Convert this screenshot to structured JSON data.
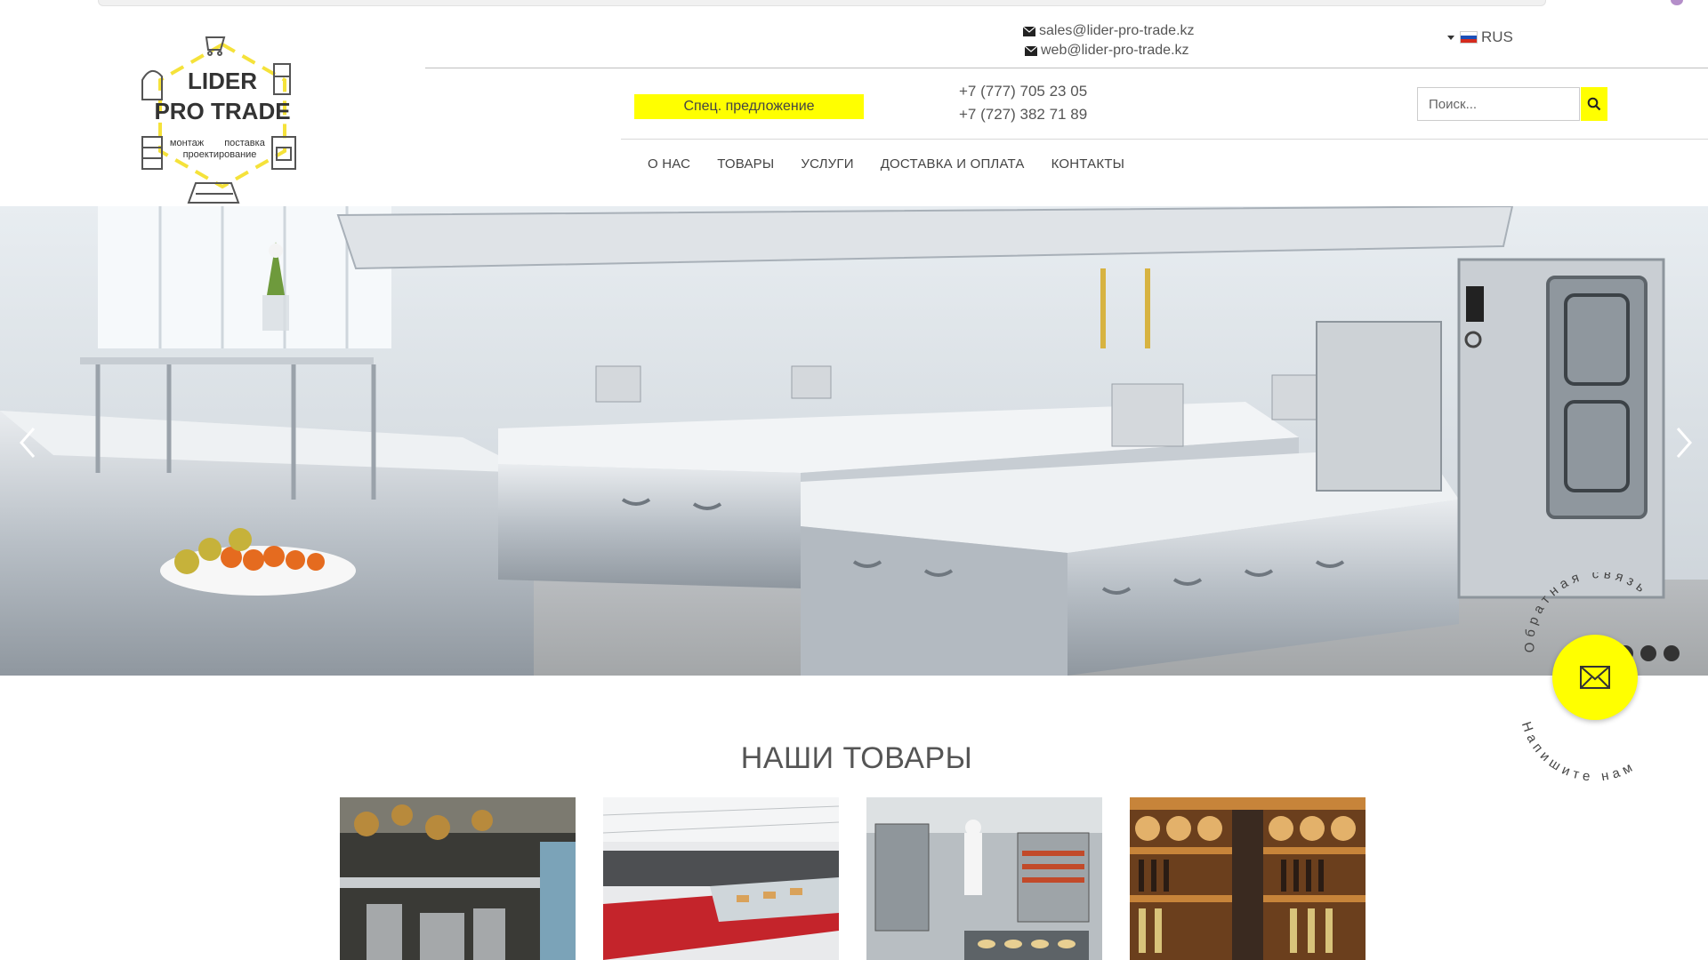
{
  "brand": {
    "logo_line1": "LIDER",
    "logo_line2": "PRO TRADE",
    "logo_tag1": "монтаж",
    "logo_tag2": "поставка",
    "logo_tag3": "проектирование",
    "accent": "#ffff00"
  },
  "header": {
    "email1": "sales@lider-pro-trade.kz",
    "email2": "web@lider-pro-trade.kz",
    "language": "RUS",
    "special_offer": "Спец. предложение",
    "phone1": "+7 (777) 705 23 05",
    "phone2": "+7 (727) 382 71 89",
    "search_placeholder": "Поиск...",
    "icons": [
      "envelope-icon",
      "flag-ru-icon",
      "search-icon"
    ]
  },
  "nav": {
    "items": [
      "О НАС",
      "ТОВАРЫ",
      "УСЛУГИ",
      "ДОСТАВКА И ОПЛАТА",
      "КОНТАКТЫ"
    ]
  },
  "hero": {
    "icons": [
      "chevron-left-icon",
      "chevron-right-icon"
    ]
  },
  "feedback": {
    "top_text": "Обратная связь",
    "bottom_text": "Напишите нам"
  },
  "products": {
    "title": "НАШИ ТОВАРЫ"
  }
}
